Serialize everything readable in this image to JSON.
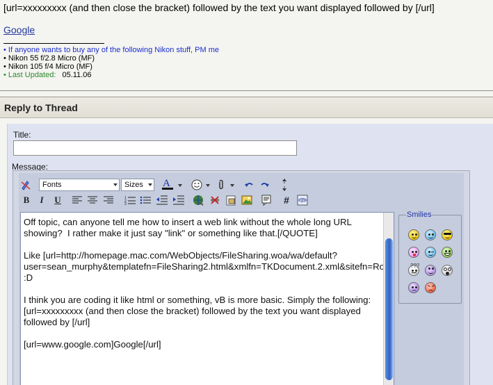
{
  "post": {
    "line1": "[url=xxxxxxxxx (and then close the bracket) followed by the text you want displayed followed by [/url]",
    "link_text": "Google"
  },
  "signature": {
    "item1": "• If anyone wants to buy any of the following Nikon stuff, PM me",
    "item2": "• Nikon 55 f/2.8 Micro (MF)",
    "item3": "• Nikon 105 f/4 Micro (MF)",
    "item4_label": "• Last Updated:",
    "item4_value": "05.11.06"
  },
  "reply": {
    "header": "Reply to Thread",
    "title_label": "Title:",
    "title_value": "",
    "message_label": "Message:"
  },
  "toolbar": {
    "font_label": "Fonts",
    "size_label": "Sizes"
  },
  "message": {
    "text": "Off topic, can anyone tell me how to insert a web link without the whole long URL showing?  I rather make it just say \"link\" or something like that.[/QUOTE]\n\nLike [url=http://homepage.mac.com/WebObjects/FileSharing.woa/wa/default?user=sean_murphy&templatefn=FileSharing2.html&xmlfn=TKDocument.2.xml&sitefn=RootSite.xml&aff=consumer&cty=US&lang=en]this[/url] :D\n\nI think you are coding it like html or something, vB is more basic. Simply the following:\n[url=xxxxxxxxx (and then close the bracket) followed by the text you want displayed followed by [/url]\n\n[url=www.google.com]Google[/url]"
  },
  "smilies": {
    "legend": "Smilies"
  }
}
